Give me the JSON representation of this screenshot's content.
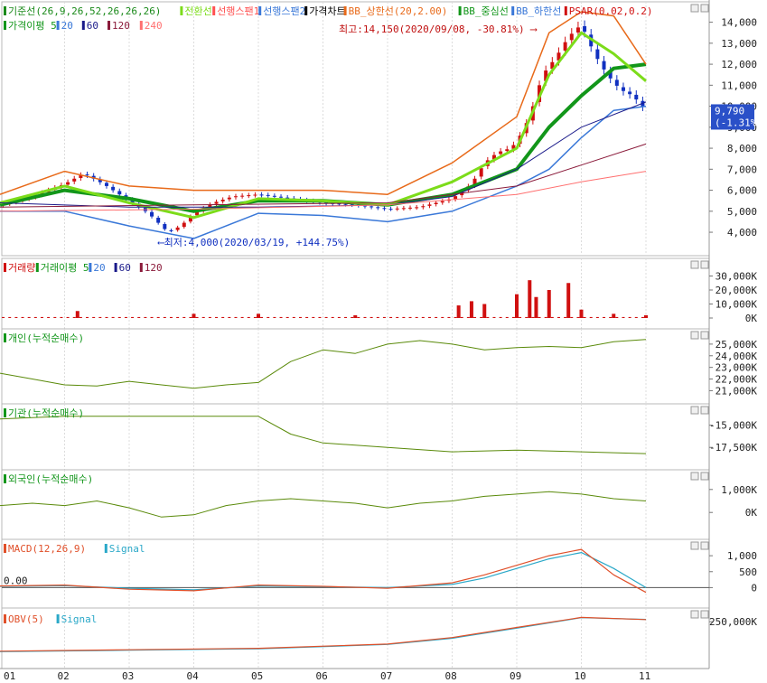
{
  "price_panel": {
    "legend_row1": [
      {
        "label": "기준선(26,9,26,52,26,26,26)",
        "color": "#1a8a1a"
      },
      {
        "label": "전환선",
        "color": "#7cdc1a"
      },
      {
        "label": "선행스팬1",
        "color": "#ff5050"
      },
      {
        "label": "선행스팬2",
        "color": "#3a78d8"
      },
      {
        "label": "가격차트",
        "color": "#000000"
      },
      {
        "label": "BB_상한선(20,2.00)",
        "color": "#e86a1a"
      },
      {
        "label": "BB_중심선",
        "color": "#12961a"
      },
      {
        "label": "BB_하한선",
        "color": "#3a78d8"
      },
      {
        "label": "PSAR(0.02,0.2)",
        "color": "#d01010"
      }
    ],
    "legend_row2": [
      {
        "label": "가격이평 5",
        "color": "#12961a"
      },
      {
        "label": "20",
        "color": "#3a78d8"
      },
      {
        "label": "60",
        "color": "#1a1a8a"
      },
      {
        "label": "120",
        "color": "#8a1a3a"
      },
      {
        "label": "240",
        "color": "#ff7070"
      }
    ],
    "high_annotation": "최고:14,150(2020/09/08, -30.81%)",
    "low_annotation": "최저:4,000(2020/03/19, +144.75%)",
    "current_price": "9,790",
    "current_change": "(-1.31%)"
  },
  "volume_panel": {
    "legend": [
      {
        "label": "거래량",
        "color": "#d01010"
      },
      {
        "label": "거래이평 5",
        "color": "#12961a"
      },
      {
        "label": "20",
        "color": "#3a78d8"
      },
      {
        "label": "60",
        "color": "#1a1a8a"
      },
      {
        "label": "120",
        "color": "#8a1a3a"
      }
    ]
  },
  "individual_panel": {
    "legend": [
      {
        "label": "개인(누적순매수)",
        "color": "#12961a"
      }
    ]
  },
  "institution_panel": {
    "legend": [
      {
        "label": "기관(누적순매수)",
        "color": "#12961a"
      }
    ]
  },
  "foreign_panel": {
    "legend": [
      {
        "label": "외국인(누적순매수)",
        "color": "#12961a"
      }
    ]
  },
  "macd_panel": {
    "legend": [
      {
        "label": "MACD(12,26,9)",
        "color": "#e0502a"
      },
      {
        "label": "Signal",
        "color": "#2aa8c8"
      }
    ],
    "zero_label": "0.00"
  },
  "obv_panel": {
    "legend": [
      {
        "label": "OBV(5)",
        "color": "#e0502a"
      },
      {
        "label": "Signal",
        "color": "#2aa8c8"
      }
    ]
  },
  "chart_data": [
    {
      "type": "line",
      "title": "",
      "x_labels": [
        "01",
        "02",
        "03",
        "04",
        "05",
        "06",
        "07",
        "08",
        "09",
        "10",
        "11"
      ],
      "y_ticks": [
        "4,000",
        "5,000",
        "6,000",
        "7,000",
        "8,000",
        "9,000",
        "10,000",
        "11,000",
        "12,000",
        "13,000",
        "14,000"
      ],
      "ylim": [
        3400,
        14800
      ],
      "series": [
        {
          "name": "가격차트",
          "x": [
            0,
            0.5,
            1,
            1.3,
            1.6,
            2,
            2.3,
            2.6,
            2.8,
            3,
            3.3,
            3.6,
            4,
            4.5,
            5,
            5.5,
            6,
            6.5,
            7,
            7.3,
            7.5,
            7.7,
            7.9,
            8,
            8.2,
            8.4,
            8.6,
            8.8,
            9,
            9.2,
            9.4,
            9.6,
            9.8,
            10
          ],
          "values": [
            5300,
            5700,
            6300,
            6800,
            6300,
            5500,
            4900,
            4000,
            4300,
            4900,
            5400,
            5700,
            5800,
            5600,
            5400,
            5300,
            5100,
            5200,
            5600,
            6300,
            7300,
            7800,
            8000,
            8300,
            9500,
            11500,
            12300,
            13300,
            13900,
            12500,
            11500,
            10800,
            10500,
            9790
          ]
        },
        {
          "name": "기준선",
          "x": [
            0,
            1,
            2,
            3,
            4,
            5,
            6,
            7,
            8,
            8.5,
            9,
            9.5,
            10
          ],
          "values": [
            5300,
            6000,
            5600,
            5000,
            5500,
            5500,
            5300,
            5800,
            7000,
            9000,
            10500,
            11800,
            12000
          ]
        },
        {
          "name": "전환선",
          "x": [
            0,
            1,
            2,
            3,
            4,
            5,
            6,
            7,
            8,
            8.5,
            9,
            9.5,
            10
          ],
          "values": [
            5400,
            6200,
            5400,
            4700,
            5600,
            5500,
            5300,
            6400,
            8000,
            11500,
            13500,
            12500,
            11200
          ]
        },
        {
          "name": "BB_상한선",
          "x": [
            0,
            1,
            2,
            3,
            4,
            5,
            6,
            7,
            8,
            8.5,
            9,
            9.5,
            10
          ],
          "values": [
            5800,
            6900,
            6200,
            6000,
            6000,
            6000,
            5800,
            7300,
            9500,
            13500,
            14500,
            14300,
            12000
          ]
        },
        {
          "name": "BB_하한선",
          "x": [
            0,
            1,
            2,
            3,
            4,
            5,
            6,
            7,
            8,
            8.5,
            9,
            9.5,
            10
          ],
          "values": [
            5000,
            5000,
            4300,
            3700,
            4900,
            4800,
            4500,
            5000,
            6200,
            7000,
            8500,
            9800,
            10000
          ]
        },
        {
          "name": "60",
          "x": [
            0,
            2,
            4,
            6,
            7,
            8,
            9,
            10
          ],
          "values": [
            5400,
            5200,
            5200,
            5300,
            5700,
            7000,
            9000,
            10200
          ]
        },
        {
          "name": "120",
          "x": [
            0,
            3,
            6,
            8,
            9,
            10
          ],
          "values": [
            5200,
            5300,
            5400,
            6200,
            7200,
            8200
          ]
        },
        {
          "name": "240",
          "x": [
            0,
            3,
            6,
            8,
            9,
            10
          ],
          "values": [
            5000,
            5100,
            5300,
            5800,
            6400,
            6900
          ]
        }
      ]
    },
    {
      "type": "bar",
      "title": "",
      "y_ticks": [
        "0K",
        "10,000K",
        "20,000K",
        "30,000K"
      ],
      "ylim": [
        0,
        40000
      ],
      "series": [
        {
          "name": "거래량",
          "x": [
            1.2,
            3,
            4,
            5.5,
            7.1,
            7.3,
            7.5,
            8,
            8.2,
            8.3,
            8.5,
            8.8,
            9,
            9.5,
            10
          ],
          "values": [
            5000,
            3000,
            3000,
            2000,
            9000,
            12000,
            10000,
            17000,
            27000,
            15000,
            20000,
            25000,
            6000,
            3000,
            2000
          ]
        }
      ]
    },
    {
      "type": "line",
      "title": "",
      "y_ticks": [
        "21,000K",
        "22,000K",
        "23,000K",
        "24,000K",
        "25,000K"
      ],
      "ylim": [
        20800,
        26000
      ],
      "series": [
        {
          "name": "개인(누적순매수)",
          "x": [
            0,
            0.5,
            1,
            1.5,
            2,
            2.5,
            3,
            3.5,
            4,
            4.5,
            5,
            5.5,
            6,
            6.5,
            7,
            7.5,
            8,
            8.5,
            9,
            9.5,
            10
          ],
          "values": [
            22500,
            22000,
            21500,
            21400,
            21800,
            21500,
            21200,
            21500,
            21700,
            23500,
            24500,
            24200,
            25000,
            25300,
            25000,
            24500,
            24700,
            24800,
            24700,
            25200,
            25400
          ]
        }
      ]
    },
    {
      "type": "line",
      "title": "",
      "y_ticks": [
        "-15,000K",
        "-17,500K"
      ],
      "ylim": [
        -18800,
        -13000
      ],
      "series": [
        {
          "name": "기관(누적순매수)",
          "x": [
            0,
            1,
            2,
            3,
            4,
            4.5,
            5,
            6,
            7,
            8,
            9,
            10
          ],
          "values": [
            -14300,
            -14000,
            -14000,
            -14000,
            -14000,
            -16000,
            -17000,
            -17500,
            -18000,
            -17800,
            -18000,
            -18200
          ]
        }
      ]
    },
    {
      "type": "line",
      "title": "",
      "y_ticks": [
        "0K",
        "1,000K"
      ],
      "ylim": [
        -700,
        1700
      ],
      "series": [
        {
          "name": "외국인(누적순매수)",
          "x": [
            0,
            0.5,
            1,
            1.5,
            2,
            2.5,
            3,
            3.5,
            4,
            4.5,
            5,
            5.5,
            6,
            6.5,
            7,
            7.5,
            8,
            8.5,
            9,
            9.5,
            10
          ],
          "values": [
            300,
            400,
            300,
            500,
            200,
            -200,
            -100,
            300,
            500,
            600,
            500,
            400,
            200,
            400,
            500,
            700,
            800,
            900,
            800,
            600,
            500
          ]
        }
      ]
    },
    {
      "type": "line",
      "title": "",
      "y_ticks": [
        "0",
        "500",
        "1,000"
      ],
      "ylim": [
        -300,
        1400
      ],
      "series": [
        {
          "name": "MACD",
          "x": [
            0,
            1,
            2,
            3,
            4,
            5,
            6,
            7,
            7.5,
            8,
            8.5,
            9,
            9.5,
            10
          ],
          "values": [
            50,
            80,
            -50,
            -100,
            80,
            40,
            -20,
            150,
            400,
            700,
            1000,
            1200,
            400,
            -150
          ]
        },
        {
          "name": "Signal",
          "x": [
            0,
            1,
            2,
            3,
            4,
            5,
            6,
            7,
            7.5,
            8,
            8.5,
            9,
            9.5,
            10
          ],
          "values": [
            40,
            60,
            -20,
            -70,
            50,
            30,
            0,
            100,
            300,
            600,
            900,
            1100,
            600,
            0
          ]
        }
      ]
    },
    {
      "type": "line",
      "title": "",
      "y_ticks": [
        "250,000K"
      ],
      "ylim": [
        0,
        320000
      ],
      "series": [
        {
          "name": "OBV",
          "x": [
            0,
            2,
            4,
            6,
            7,
            8,
            9,
            10
          ],
          "values": [
            45000,
            55000,
            65000,
            95000,
            140000,
            210000,
            280000,
            265000
          ]
        },
        {
          "name": "Signal",
          "x": [
            0,
            2,
            4,
            6,
            7,
            8,
            9,
            10
          ],
          "values": [
            42000,
            52000,
            62000,
            92000,
            135000,
            205000,
            278000,
            266000
          ]
        }
      ]
    }
  ]
}
